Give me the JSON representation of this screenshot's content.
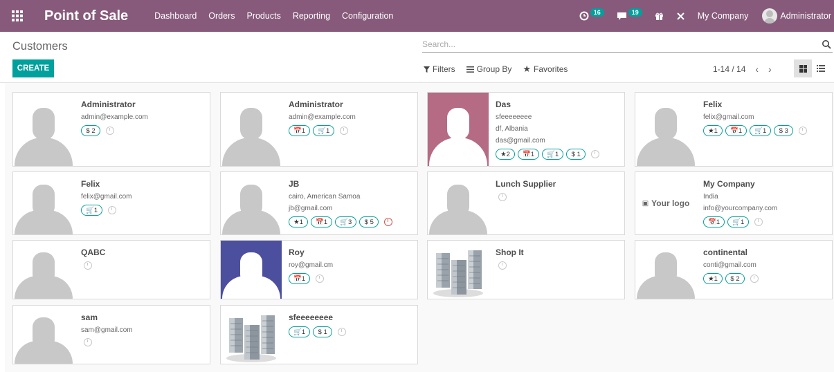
{
  "app": {
    "title": "Point of Sale",
    "menu": [
      "Dashboard",
      "Orders",
      "Products",
      "Reporting",
      "Configuration"
    ],
    "activity_count": "16",
    "message_count": "19",
    "company": "My Company",
    "user": "Administrator"
  },
  "control_panel": {
    "breadcrumb": "Customers",
    "create_label": "CREATE",
    "search_placeholder": "Search...",
    "filters_label": "Filters",
    "groupby_label": "Group By",
    "favorites_label": "Favorites",
    "pager": "1-14 / 14"
  },
  "colors": {
    "navbar": "#875a7b",
    "primary": "#00a09d",
    "das_bg": "#b46b83",
    "roy_bg": "#4c4f9d"
  },
  "cards": [
    {
      "name": "Administrator",
      "lines": [
        "admin@example.com"
      ],
      "tags": [
        "$ 2"
      ],
      "image": "placeholder"
    },
    {
      "name": "Administrator",
      "lines": [
        "admin@example.com"
      ],
      "tags": [
        "📅1",
        "🛒1"
      ],
      "image": "placeholder"
    },
    {
      "name": "Das",
      "lines": [
        "sfeeeeeeee",
        "df, Albania",
        "das@gmail.com"
      ],
      "tags": [
        "★2",
        "📅1",
        "🛒1",
        "$ 1"
      ],
      "image": "colored-pink"
    },
    {
      "name": "Felix",
      "lines": [
        "felix@gmail.com"
      ],
      "tags": [
        "★1",
        "📅1",
        "🛒1",
        "$ 3"
      ],
      "image": "placeholder"
    },
    {
      "name": "Felix",
      "lines": [
        "felix@gmail.com"
      ],
      "tags": [
        "🛒1"
      ],
      "image": "placeholder"
    },
    {
      "name": "JB",
      "lines": [
        "cairo, American Samoa",
        "jb@gmail.com"
      ],
      "tags": [
        "★1",
        "📅1",
        "🛒3",
        "$ 5"
      ],
      "image": "placeholder",
      "overdue": true
    },
    {
      "name": "Lunch Supplier",
      "lines": [],
      "tags": [],
      "image": "placeholder"
    },
    {
      "name": "My Company",
      "lines": [
        "India",
        "info@yourcompany.com"
      ],
      "tags": [
        "📅1",
        "🛒1"
      ],
      "image": "logo",
      "logo_text": "Your logo"
    },
    {
      "name": "QABC",
      "lines": [],
      "tags": [],
      "image": "placeholder"
    },
    {
      "name": "Roy",
      "lines": [
        "roy@gmail.cm"
      ],
      "tags": [
        "📅1"
      ],
      "image": "colored-blue"
    },
    {
      "name": "Shop It",
      "lines": [],
      "tags": [],
      "image": "building"
    },
    {
      "name": "continental",
      "lines": [
        "conti@gmail.com"
      ],
      "tags": [
        "★1",
        "$ 2"
      ],
      "image": "placeholder"
    },
    {
      "name": "sam",
      "lines": [
        "sam@gmail.com"
      ],
      "tags": [],
      "image": "placeholder"
    },
    {
      "name": "sfeeeeeeee",
      "lines": [],
      "tags": [
        "🛒1",
        "$ 1"
      ],
      "image": "building"
    }
  ]
}
